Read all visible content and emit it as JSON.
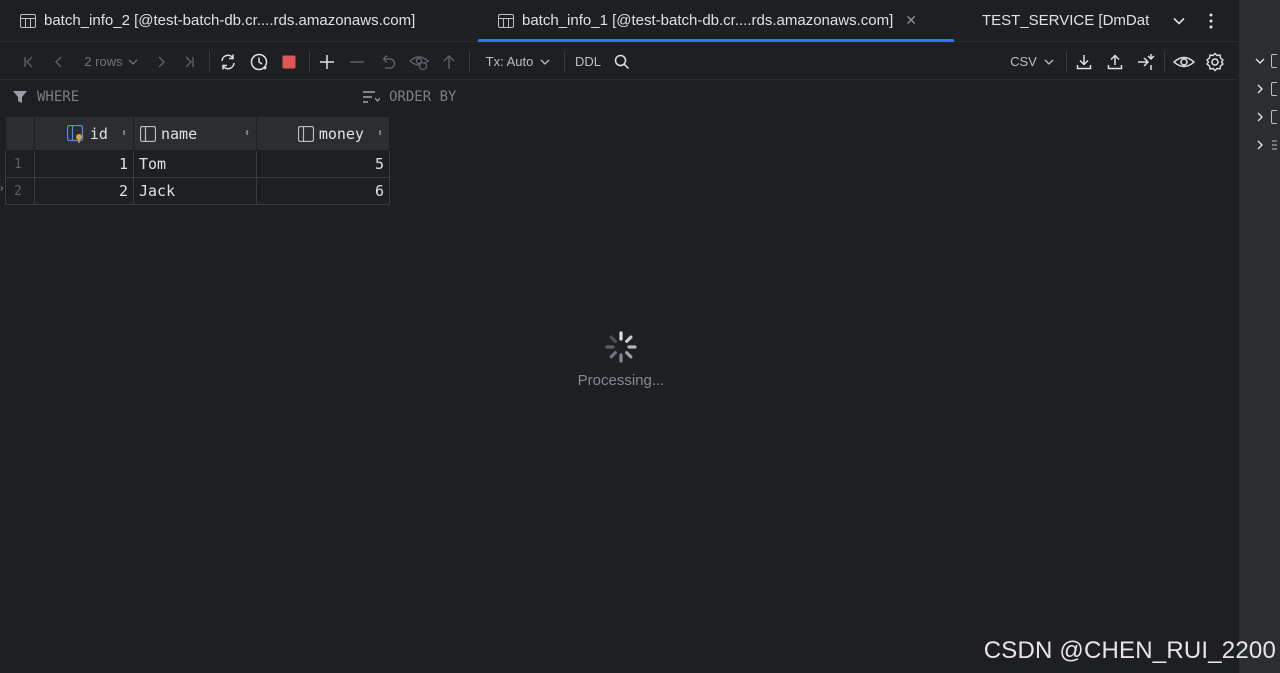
{
  "tabs": [
    {
      "label": "batch_info_2 [@test-batch-db.cr....rds.amazonaws.com]",
      "active": false
    },
    {
      "label": "batch_info_1 [@test-batch-db.cr....rds.amazonaws.com]",
      "active": true
    },
    {
      "label": "TEST_SERVICE [DmDat",
      "active": false
    }
  ],
  "toolbar": {
    "rows_label": "2 rows",
    "tx_label": "Tx: Auto",
    "ddl_label": "DDL",
    "export_format": "CSV"
  },
  "filters": {
    "where_label": "WHERE",
    "order_label": "ORDER BY"
  },
  "grid": {
    "columns": [
      "id",
      "name",
      "money"
    ],
    "rows": [
      {
        "rownum": "1",
        "id": "1",
        "name": "Tom",
        "money": "5"
      },
      {
        "rownum": "2",
        "id": "2",
        "name": "Jack",
        "money": "6"
      }
    ]
  },
  "status": {
    "processing_label": "Processing..."
  },
  "watermark": "CSDN @CHEN_RUI_2200",
  "colors": {
    "background": "#1e1f22",
    "accent": "#3574f0",
    "stop": "#e05555"
  }
}
